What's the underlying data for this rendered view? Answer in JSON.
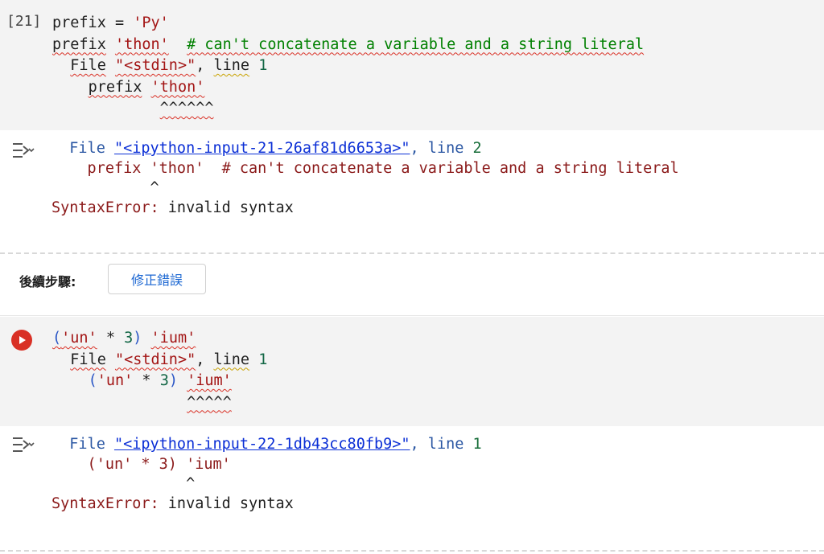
{
  "cell1": {
    "prompt": "[21]",
    "code_lines": [
      [
        {
          "t": "prefix",
          "c": "tok-var"
        },
        {
          "t": " = ",
          "c": "tok-punc"
        },
        {
          "t": "'Py'",
          "c": "tok-str"
        }
      ],
      [
        {
          "t": "prefix",
          "c": "tok-var",
          "s": "squig"
        },
        {
          "t": " ",
          "c": "tok-punc"
        },
        {
          "t": "'thon'",
          "c": "tok-str",
          "s": "squig"
        },
        {
          "t": "  ",
          "c": "tok-punc"
        },
        {
          "t": "# can't concatenate a variable and a string literal",
          "c": "tok-cmt",
          "s": "squig"
        }
      ],
      [
        {
          "t": "  ",
          "c": "tok-punc"
        },
        {
          "t": "File",
          "c": "tok-kw",
          "s": "squig"
        },
        {
          "t": " ",
          "c": "tok-punc"
        },
        {
          "t": "\"<stdin>\"",
          "c": "tok-str",
          "s": "squig"
        },
        {
          "t": ", ",
          "c": "tok-punc"
        },
        {
          "t": "line",
          "c": "tok-kw",
          "s": "squig-y"
        },
        {
          "t": " ",
          "c": "tok-punc"
        },
        {
          "t": "1",
          "c": "tok-num"
        }
      ],
      [
        {
          "t": "    ",
          "c": "tok-punc"
        },
        {
          "t": "prefix",
          "c": "tok-var",
          "s": "squig"
        },
        {
          "t": " ",
          "c": "tok-punc"
        },
        {
          "t": "'thon'",
          "c": "tok-str",
          "s": "squig"
        }
      ],
      [
        {
          "t": "            ",
          "c": "tok-punc"
        },
        {
          "t": "^^^^^^",
          "c": "tok-kw",
          "s": "squig"
        }
      ]
    ],
    "output_lines": [
      [
        {
          "t": "  File ",
          "c": "o-blue"
        },
        {
          "t": "\"<ipython-input-21-26af81d6653a>\"",
          "c": "o-link"
        },
        {
          "t": ", line ",
          "c": "o-blue"
        },
        {
          "t": "2",
          "c": "o-green"
        }
      ],
      [
        {
          "t": "    prefix 'thon'  # can't concatenate a variable and a string literal",
          "c": "o-red"
        }
      ],
      [
        {
          "t": "           ^",
          "c": "o-plain"
        }
      ],
      [
        {
          "t": "SyntaxError: ",
          "c": "o-red"
        },
        {
          "t": "invalid syntax",
          "c": "o-plain"
        }
      ]
    ]
  },
  "next_steps": {
    "label": "後續步驟:",
    "fix_button": "修正錯誤"
  },
  "cell2": {
    "code_lines": [
      [
        {
          "t": "(",
          "c": "tok-blue",
          "s": "squig"
        },
        {
          "t": "'un'",
          "c": "tok-str",
          "s": "squig"
        },
        {
          "t": " * ",
          "c": "tok-punc"
        },
        {
          "t": "3",
          "c": "tok-num"
        },
        {
          "t": ")",
          "c": "tok-blue"
        },
        {
          "t": " ",
          "c": "tok-punc"
        },
        {
          "t": "'ium'",
          "c": "tok-str",
          "s": "squig"
        }
      ],
      [
        {
          "t": "  ",
          "c": "tok-punc"
        },
        {
          "t": "File",
          "c": "tok-kw",
          "s": "squig"
        },
        {
          "t": " ",
          "c": "tok-punc"
        },
        {
          "t": "\"<stdin>\"",
          "c": "tok-str",
          "s": "squig"
        },
        {
          "t": ", ",
          "c": "tok-punc"
        },
        {
          "t": "line",
          "c": "tok-kw",
          "s": "squig-y"
        },
        {
          "t": " ",
          "c": "tok-punc"
        },
        {
          "t": "1",
          "c": "tok-num"
        }
      ],
      [
        {
          "t": "    ",
          "c": "tok-punc"
        },
        {
          "t": "(",
          "c": "tok-blue"
        },
        {
          "t": "'un'",
          "c": "tok-str"
        },
        {
          "t": " * ",
          "c": "tok-punc"
        },
        {
          "t": "3",
          "c": "tok-num"
        },
        {
          "t": ")",
          "c": "tok-blue"
        },
        {
          "t": " ",
          "c": "tok-punc"
        },
        {
          "t": "'ium'",
          "c": "tok-str",
          "s": "squig"
        }
      ],
      [
        {
          "t": "               ",
          "c": "tok-punc"
        },
        {
          "t": "^^^^^",
          "c": "tok-kw",
          "s": "squig"
        }
      ]
    ],
    "output_lines": [
      [
        {
          "t": "  File ",
          "c": "o-blue"
        },
        {
          "t": "\"<ipython-input-22-1db43cc80fb9>\"",
          "c": "o-link"
        },
        {
          "t": ", line ",
          "c": "o-blue"
        },
        {
          "t": "1",
          "c": "o-green"
        }
      ],
      [
        {
          "t": "    ('un' * 3) 'ium'",
          "c": "o-red"
        }
      ],
      [
        {
          "t": "               ^",
          "c": "o-plain"
        }
      ],
      [
        {
          "t": "SyntaxError: ",
          "c": "o-red"
        },
        {
          "t": "invalid syntax",
          "c": "o-plain"
        }
      ]
    ]
  },
  "icons": {
    "output_toggle": "output-collapse-icon",
    "run": "run-error-icon"
  }
}
